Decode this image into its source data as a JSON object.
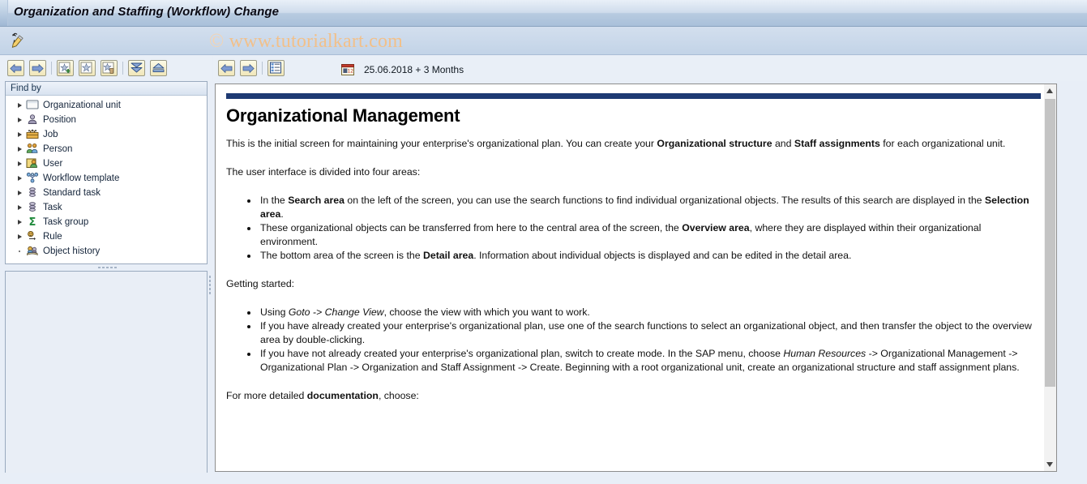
{
  "window": {
    "title": "Organization and Staffing (Workflow) Change",
    "watermark_symbol": "©",
    "watermark_text": "www.tutorialkart.com"
  },
  "app_toolbar": {
    "icons": [
      {
        "name": "pencil-icon",
        "label": "Change mode"
      }
    ]
  },
  "left_toolbar": {
    "buttons": [
      {
        "name": "back-button",
        "label": "Back",
        "icon": "arrow-left-icon"
      },
      {
        "name": "forward-button",
        "label": "Forward",
        "icon": "arrow-right-icon"
      },
      {
        "name": "create-button",
        "label": "Create",
        "icon": "new-star-plus-icon"
      },
      {
        "name": "change-button",
        "label": "Change",
        "icon": "star-icon"
      },
      {
        "name": "delete-button",
        "label": "Delete",
        "icon": "star-delete-icon"
      },
      {
        "name": "expand-all-button",
        "label": "Expand all",
        "icon": "expand-down-icon"
      },
      {
        "name": "collapse-all-button",
        "label": "Collapse all",
        "icon": "collapse-up-icon"
      }
    ]
  },
  "right_toolbar": {
    "buttons": [
      {
        "name": "back-button",
        "label": "Back",
        "icon": "arrow-left-icon"
      },
      {
        "name": "forward-button",
        "label": "Forward",
        "icon": "arrow-right-icon"
      },
      {
        "name": "column-config-button",
        "label": "Column configuration",
        "icon": "list-settings-icon"
      }
    ],
    "validity": {
      "icon": "calendar-icon",
      "date": "25.06.2018",
      "offset": "+ 3 Months",
      "display": "25.06.2018  + 3 Months"
    }
  },
  "find_panel": {
    "header": "Find by",
    "items": [
      {
        "label": "Organizational unit",
        "icon": "org-unit-icon",
        "expandable": true
      },
      {
        "label": "Position",
        "icon": "position-icon",
        "expandable": true
      },
      {
        "label": "Job",
        "icon": "job-icon",
        "expandable": true
      },
      {
        "label": "Person",
        "icon": "person-icon",
        "expandable": true
      },
      {
        "label": "User",
        "icon": "user-icon",
        "expandable": true
      },
      {
        "label": "Workflow template",
        "icon": "workflow-template-icon",
        "expandable": true
      },
      {
        "label": "Standard task",
        "icon": "standard-task-icon",
        "expandable": true
      },
      {
        "label": "Task",
        "icon": "task-icon",
        "expandable": true
      },
      {
        "label": "Task group",
        "icon": "task-group-icon",
        "expandable": true
      },
      {
        "label": "Rule",
        "icon": "rule-icon",
        "expandable": true
      },
      {
        "label": "Object history",
        "icon": "object-history-icon",
        "expandable": false
      }
    ]
  },
  "content": {
    "heading": "Organizational Management",
    "intro_parts": [
      "This is the initial screen for maintaining your enterprise's organizational plan. You can create your ",
      "Organizational structure",
      " and ",
      "Staff assignments",
      " for each organizational unit."
    ],
    "areas_lead": "The user interface is divided into four areas:",
    "area_bullets": [
      [
        "In the ",
        "Search area",
        " on the left of the screen, you can use the search functions to find individual organizational objects. The results of this search are displayed in the ",
        "Selection area",
        "."
      ],
      [
        "These organizational objects can be transferred from here to the central area of the screen, the ",
        "Overview area",
        ", where they are displayed within their organizational environment."
      ],
      [
        "The bottom area of the screen is the ",
        "Detail area",
        ". Information about individual objects is displayed and can be edited in the detail area."
      ]
    ],
    "getting_started_lead": "Getting started:",
    "getting_started_bullets": [
      [
        "Using ",
        "Goto -> Change View",
        ", choose the view with which you want to work."
      ],
      [
        "If you have already created your enterprise's organizational plan, use one of the search functions to select an organizational object, and then transfer the object to the overview area by double-clicking."
      ],
      [
        "If you have not already created your enterprise's organizational plan, switch to create mode. In the SAP menu, choose ",
        "Human Resources",
        " -> Organizational Management -> Organizational Plan -> Organization and Staff Assignment -> Create. Beginning with a root organizational unit, create an organizational structure and staff assignment plans."
      ]
    ],
    "footer_parts": [
      "For more detailed ",
      "documentation",
      ", choose:"
    ]
  },
  "colors": {
    "title_bar_accent": "#a9c0da",
    "doc_rule": "#1e3a73",
    "watermark": "#f2c08a",
    "toolbar_button": "#f0e6b9"
  }
}
